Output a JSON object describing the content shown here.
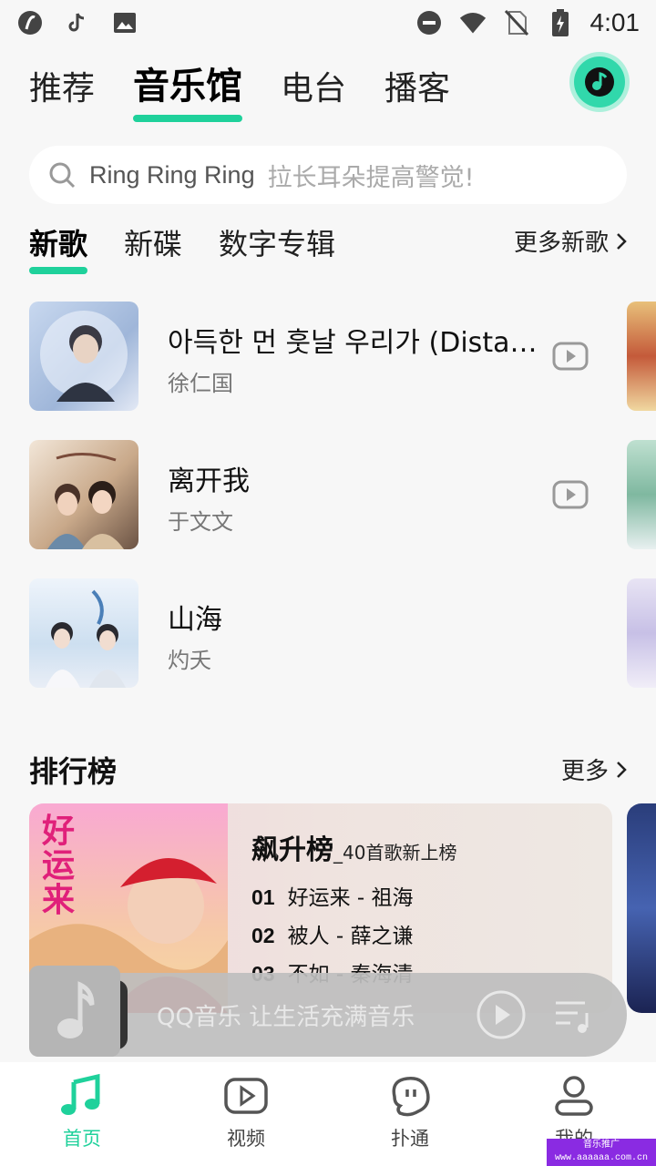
{
  "status_bar": {
    "time": "4:01",
    "icons": [
      "app-icon",
      "tiktok-icon",
      "image-icon",
      "dnd-icon",
      "wifi-icon",
      "no-sim-icon",
      "battery-charging-icon"
    ]
  },
  "top_tabs": [
    {
      "label": "推荐"
    },
    {
      "label": "音乐馆",
      "active": true
    },
    {
      "label": "电台"
    },
    {
      "label": "播客"
    }
  ],
  "search": {
    "keyword": "Ring Ring Ring",
    "hint": "拉长耳朵提高警觉!"
  },
  "new_songs": {
    "tabs": [
      {
        "label": "新歌",
        "active": true
      },
      {
        "label": "新碟"
      },
      {
        "label": "数字专辑"
      }
    ],
    "more_label": "更多新歌",
    "items": [
      {
        "title": "아득한 먼 훗날 우리가 (Distant Future)",
        "artist": "徐仁国",
        "has_mv": true
      },
      {
        "title": "离开我",
        "artist": "于文文",
        "has_mv": true
      },
      {
        "title": "山海",
        "artist": "灼夭",
        "has_mv": false
      }
    ]
  },
  "ranking": {
    "title": "排行榜",
    "more_label": "更多",
    "card": {
      "name": "飙升榜",
      "subtitle": "_40首歌新上榜",
      "cover_text": "好运来",
      "rows": [
        {
          "rank": "01",
          "text": "好运来 - 祖海"
        },
        {
          "rank": "02",
          "text": "被人 - 薛之谦"
        },
        {
          "rank": "03",
          "text": "不如 - 秦海清"
        }
      ]
    }
  },
  "mini_player": {
    "text": "QQ音乐 让生活充满音乐"
  },
  "bottom_nav": [
    {
      "label": "首页",
      "active": true
    },
    {
      "label": "视频"
    },
    {
      "label": "扑通"
    },
    {
      "label": "我的"
    }
  ],
  "watermark": {
    "line1": "音乐推广",
    "line2": "www.aaaaaa.com.cn"
  },
  "colors": {
    "accent": "#1fd19b",
    "background": "#f7f7f7"
  }
}
